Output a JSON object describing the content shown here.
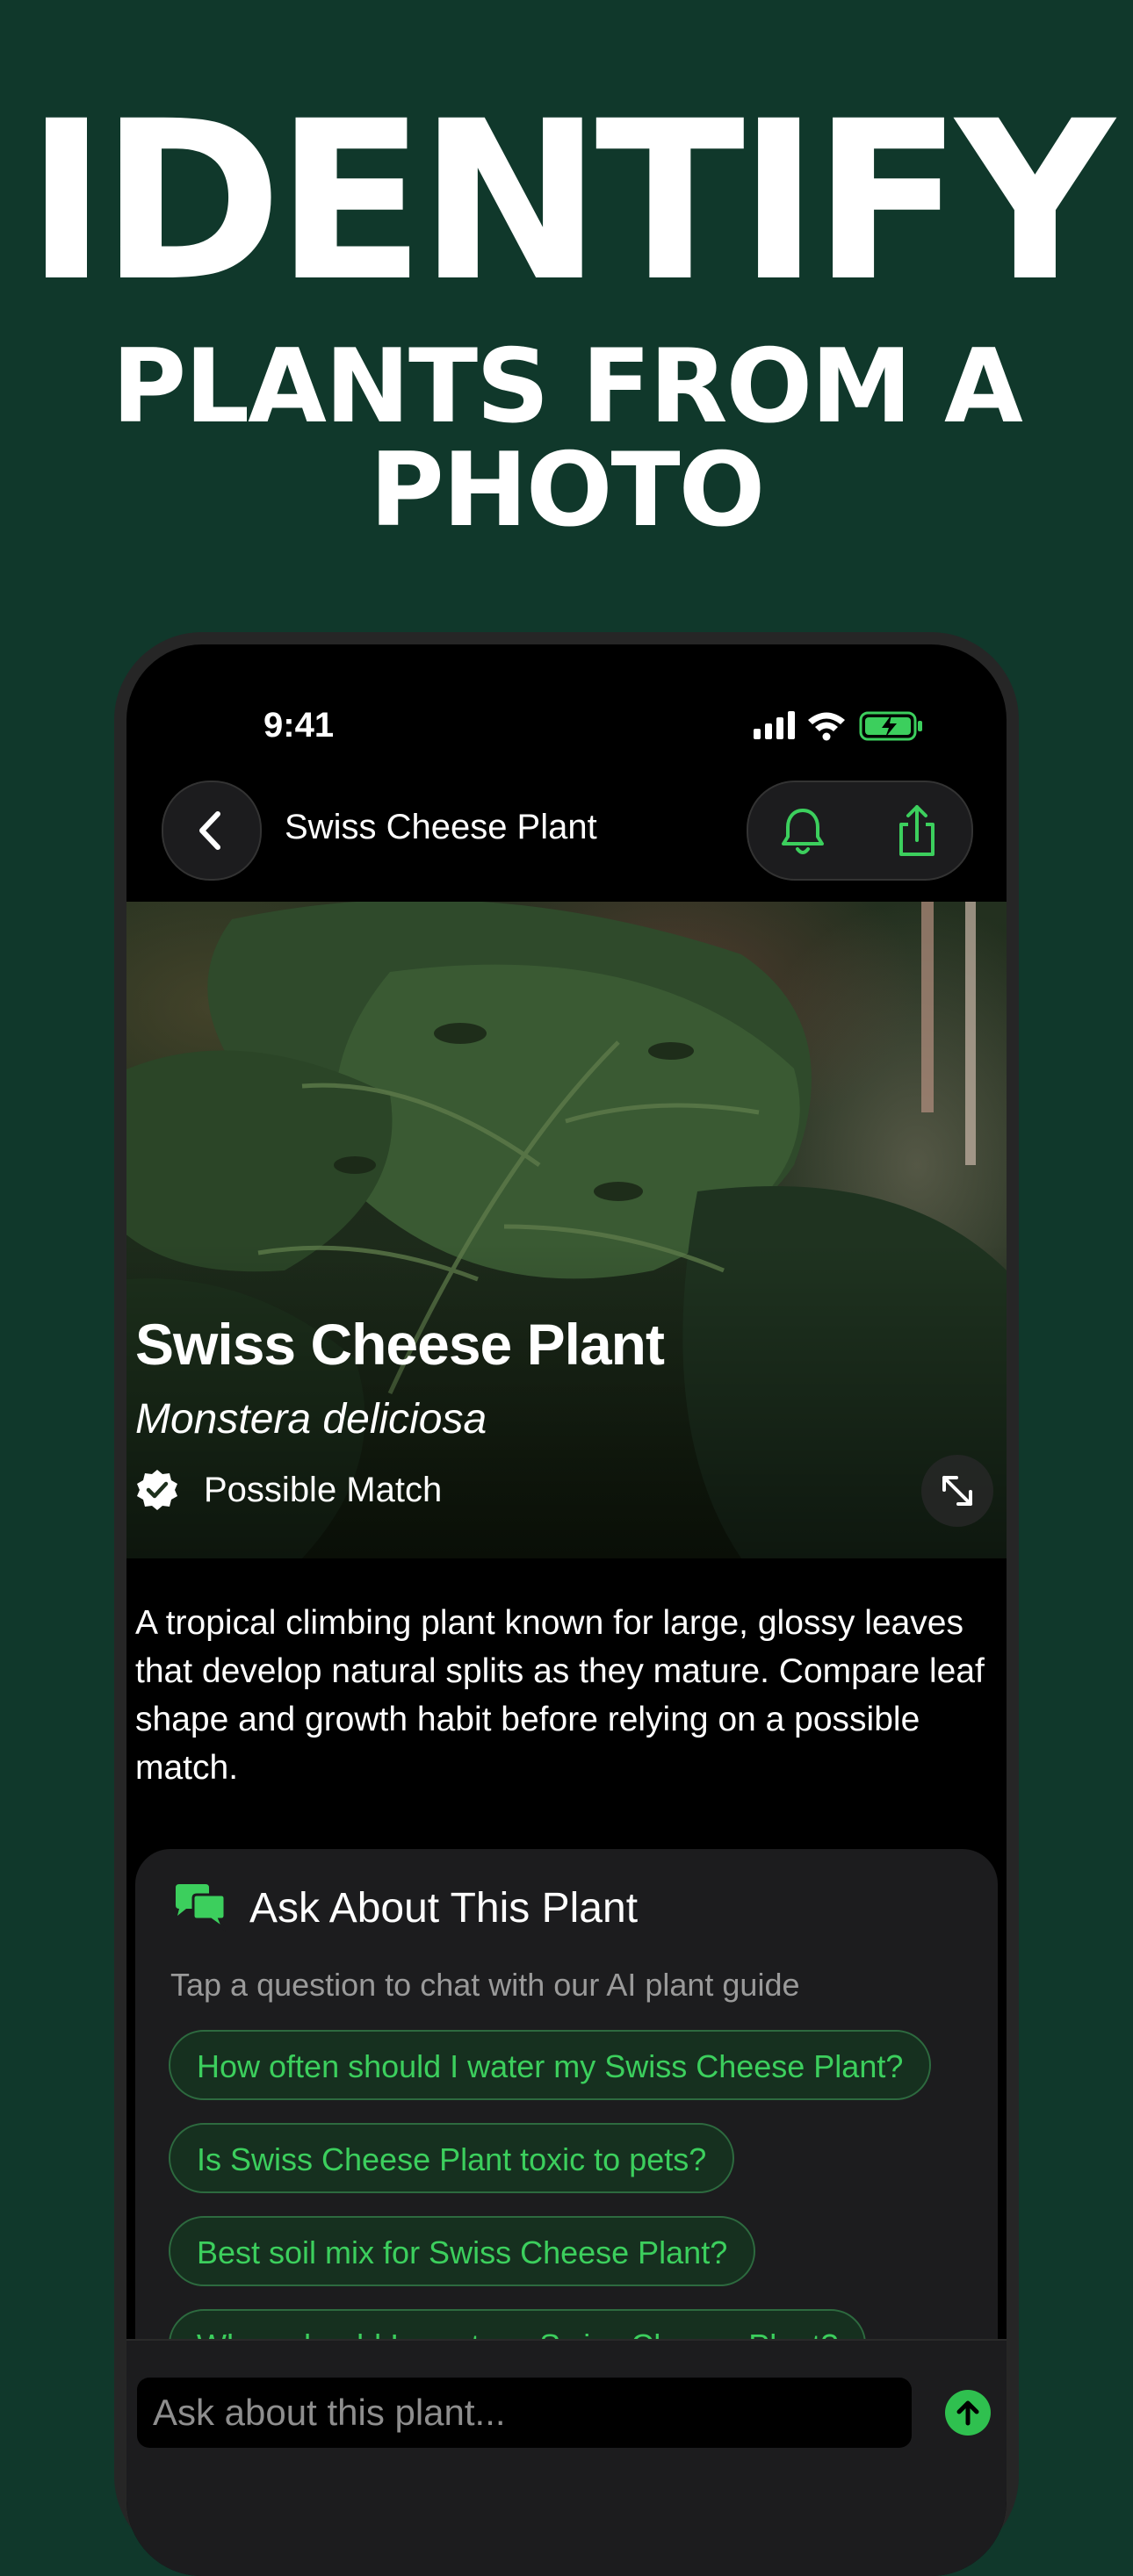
{
  "promo": {
    "headline": "IDENTIFY",
    "subheadline_line1": "PLANTS FROM A",
    "subheadline_line2": "PHOTO"
  },
  "status_bar": {
    "time": "9:41"
  },
  "nav": {
    "title": "Swiss Cheese Plant"
  },
  "plant": {
    "common_name": "Swiss Cheese Plant",
    "scientific_name": "Monstera deliciosa",
    "match_label": "Possible Match",
    "description": "A tropical climbing plant known for large, glossy leaves that develop natural splits as they mature. Compare leaf shape and growth habit before relying on a possible match."
  },
  "ask": {
    "title": "Ask About This Plant",
    "subtitle": "Tap a question to chat with our AI plant guide",
    "questions": [
      "How often should I water my Swiss Cheese Plant?",
      "Is Swiss Cheese Plant toxic to pets?",
      "Best soil mix for Swiss Cheese Plant?",
      "When should I repot my Swiss Cheese Plant?"
    ]
  },
  "input": {
    "placeholder": "Ask about this plant..."
  },
  "colors": {
    "background": "#10382b",
    "accent": "#3ccf5d",
    "screen": "#000000"
  },
  "icons": [
    "back-chevron-icon",
    "bell-icon",
    "share-icon",
    "verified-badge-icon",
    "expand-icon",
    "chat-bubbles-icon",
    "send-arrow-icon",
    "signal-icon",
    "wifi-icon",
    "battery-icon"
  ]
}
